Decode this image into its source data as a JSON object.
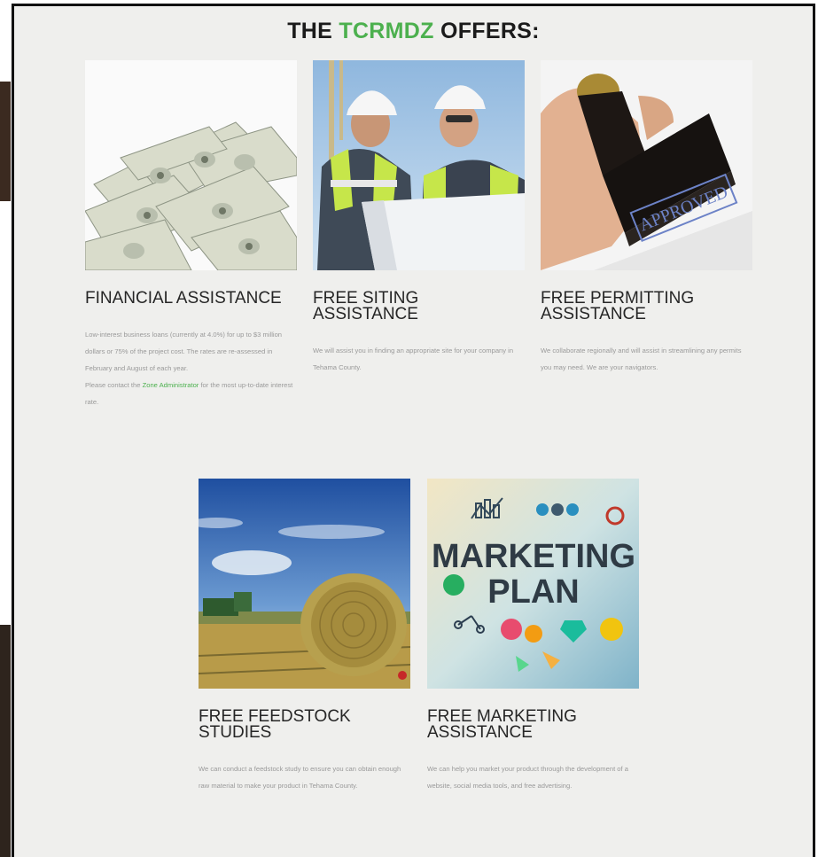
{
  "page": {
    "title_prefix": "THE ",
    "title_brand": "TCRMDZ",
    "title_suffix": " OFFERS:",
    "accent_color": "#4cb04e"
  },
  "offers": [
    {
      "heading": "FINANCIAL ASSISTANCE",
      "image": "money-stack-image",
      "paragraphs": [
        "Low-interest business loans (currently at 4.0%) for up to $3 million dollars or 75% of the project cost. The rates are re-assessed in February and August of each year.",
        "Please contact the ",
        "Zone Administrator",
        " for the most up-to-date interest rate."
      ]
    },
    {
      "heading": "FREE SITING ASSISTANCE",
      "image": "engineers-blueprint-image",
      "paragraphs": [
        "We will assist you in finding an appropriate site for your company in Tehama County."
      ]
    },
    {
      "heading": "FREE PERMITTING ASSISTANCE",
      "image": "approved-stamp-image",
      "stamp_text": "APPROVED",
      "paragraphs": [
        "We collaborate regionally and will assist in streamlining any permits you may need. We are your navigators."
      ]
    },
    {
      "heading": "FREE FEEDSTOCK STUDIES",
      "image": "hay-bale-field-image",
      "paragraphs": [
        "We can conduct a feedstock study to ensure you can obtain enough raw material to make your product in Tehama County."
      ]
    },
    {
      "heading": "FREE MARKETING ASSISTANCE",
      "image": "marketing-plan-image",
      "image_text": [
        "MARKETING",
        "PLAN"
      ],
      "paragraphs": [
        "We can help you market your product through the development of a website, social media tools, and free advertising."
      ]
    }
  ]
}
